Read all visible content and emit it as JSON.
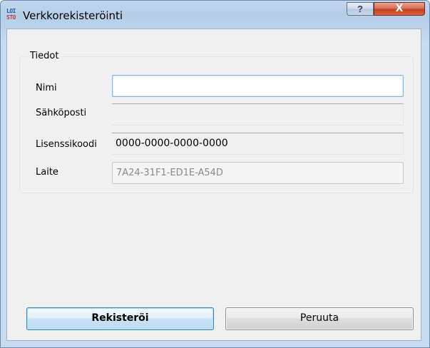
{
  "window": {
    "title": "Verkkorekisteröinti",
    "icon_top": "LOI",
    "icon_bottom": "STO",
    "help_label": "?",
    "close_label": "X"
  },
  "group": {
    "title": "Tiedot"
  },
  "fields": [
    {
      "label": "Nimi",
      "value": ""
    },
    {
      "label": "Sähköposti",
      "value": ""
    },
    {
      "label": "Lisenssikoodi",
      "value": "0000-0000-0000-0000"
    },
    {
      "label": "Laite",
      "value": "7A24-31F1-ED1E-A54D"
    }
  ],
  "buttons": {
    "register": "Rekisteröi",
    "cancel": "Peruuta"
  }
}
